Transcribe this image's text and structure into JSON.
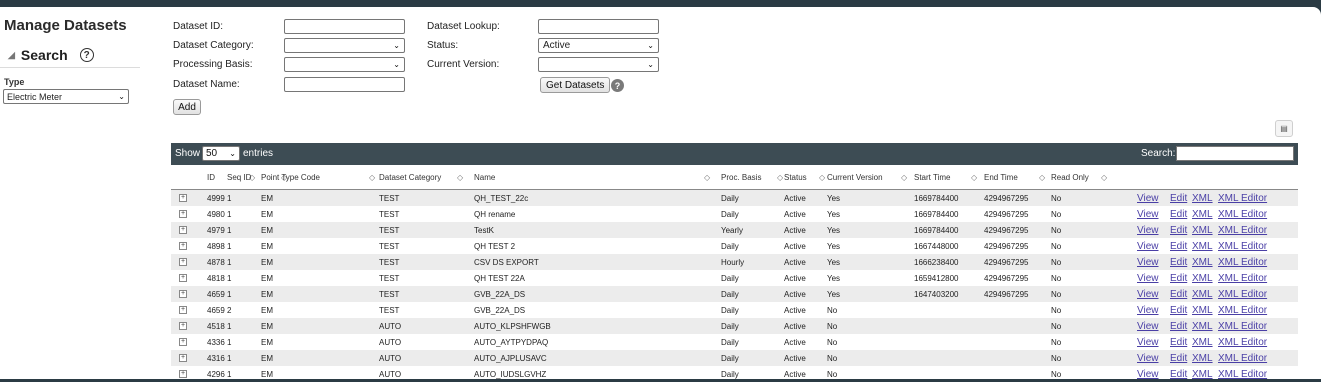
{
  "page_title": "Manage Datasets",
  "search_panel": {
    "label": "Search",
    "help": "?",
    "type_label": "Type",
    "type_value": "Electric Meter"
  },
  "filters": {
    "dataset_id_label": "Dataset ID:",
    "dataset_id_value": "",
    "dataset_lookup_label": "Dataset Lookup:",
    "dataset_lookup_value": "",
    "dataset_category_label": "Dataset Category:",
    "dataset_category_value": "",
    "status_label": "Status:",
    "status_value": "Active",
    "processing_basis_label": "Processing Basis:",
    "processing_basis_value": "",
    "current_version_label": "Current Version:",
    "current_version_value": "",
    "dataset_name_label": "Dataset Name:",
    "dataset_name_value": "",
    "get_datasets": "Get Datasets",
    "help": "?",
    "add": "Add"
  },
  "table": {
    "show_label": "Show",
    "page_length": "50",
    "entries_label": "entries",
    "search_label": "Search:",
    "columns": [
      "ID",
      "Seq ID",
      "Point Type Code",
      "Dataset Category",
      "Name",
      "Proc. Basis",
      "Status",
      "Current Version",
      "Start Time",
      "End Time",
      "Read Only"
    ],
    "link_labels": [
      "View",
      "Edit",
      "XML",
      "XML Editor"
    ],
    "rows": [
      [
        "4999",
        "1",
        "EM",
        "TEST",
        "QH_TEST_22c",
        "Daily",
        "Active",
        "Yes",
        "1669784400",
        "4294967295",
        "No"
      ],
      [
        "4980",
        "1",
        "EM",
        "TEST",
        "QH rename",
        "Daily",
        "Active",
        "Yes",
        "1669784400",
        "4294967295",
        "No"
      ],
      [
        "4979",
        "1",
        "EM",
        "TEST",
        "TestK",
        "Yearly",
        "Active",
        "Yes",
        "1669784400",
        "4294967295",
        "No"
      ],
      [
        "4898",
        "1",
        "EM",
        "TEST",
        "QH TEST 2",
        "Daily",
        "Active",
        "Yes",
        "1667448000",
        "4294967295",
        "No"
      ],
      [
        "4878",
        "1",
        "EM",
        "TEST",
        "CSV DS EXPORT",
        "Hourly",
        "Active",
        "Yes",
        "1666238400",
        "4294967295",
        "No"
      ],
      [
        "4818",
        "1",
        "EM",
        "TEST",
        "QH TEST 22A",
        "Daily",
        "Active",
        "Yes",
        "1659412800",
        "4294967295",
        "No"
      ],
      [
        "4659",
        "1",
        "EM",
        "TEST",
        "GVB_22A_DS",
        "Daily",
        "Active",
        "Yes",
        "1647403200",
        "4294967295",
        "No"
      ],
      [
        "4659",
        "2",
        "EM",
        "TEST",
        "GVB_22A_DS",
        "Daily",
        "Active",
        "No",
        "",
        "",
        "No"
      ],
      [
        "4518",
        "1",
        "EM",
        "AUTO",
        "AUTO_KLPSHFWGB",
        "Daily",
        "Active",
        "No",
        "",
        "",
        "No"
      ],
      [
        "4336",
        "1",
        "EM",
        "AUTO",
        "AUTO_AYTPYDPAQ",
        "Daily",
        "Active",
        "No",
        "",
        "",
        "No"
      ],
      [
        "4316",
        "1",
        "EM",
        "AUTO",
        "AUTO_AJPLUSAVC",
        "Daily",
        "Active",
        "No",
        "",
        "",
        "No"
      ],
      [
        "4296",
        "1",
        "EM",
        "AUTO",
        "AUTO_IUDSLGVHZ",
        "Daily",
        "Active",
        "No",
        "",
        "",
        "No"
      ]
    ]
  }
}
